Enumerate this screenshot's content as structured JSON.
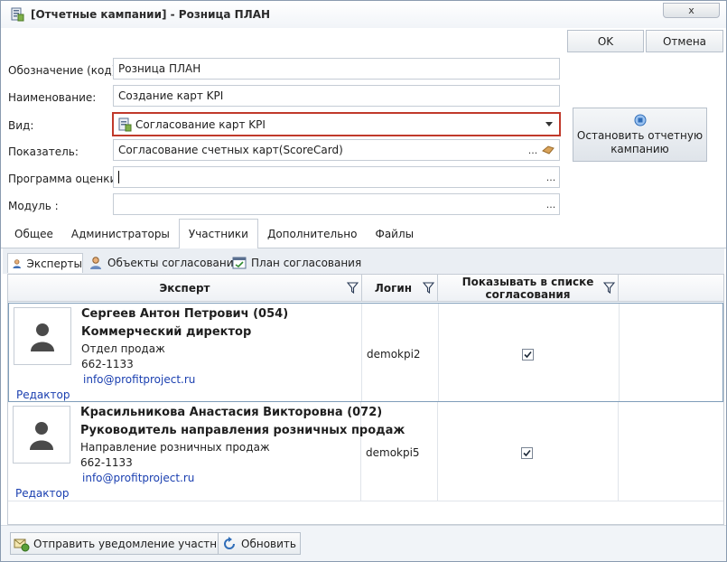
{
  "window": {
    "title": "[Отчетные кампании] - Розница ПЛАН",
    "close_label": "x"
  },
  "buttons": {
    "ok": "OK",
    "cancel": "Отмена",
    "stop": "Остановить отчетную кампанию"
  },
  "form": {
    "code": {
      "label": "Обозначение (код):",
      "value": "Розница ПЛАН"
    },
    "name": {
      "label": "Наименование:",
      "value": "Создание карт KPI"
    },
    "kind": {
      "label": "Вид:",
      "value": "Согласование карт KPI"
    },
    "indicator": {
      "label": "Показатель:",
      "value": "Согласование счетных карт(ScoreCard)",
      "dots": "..."
    },
    "program": {
      "label": "Программа оценки :",
      "value": "",
      "dots": "..."
    },
    "module": {
      "label": "Модуль :",
      "value": "",
      "dots": "..."
    }
  },
  "tabs": [
    "Общее",
    "Администраторы",
    "Участники",
    "Дополнительно",
    "Файлы"
  ],
  "subtabs": [
    "Эксперты",
    "Объекты согласования",
    "План согласования"
  ],
  "grid": {
    "headers": {
      "expert": "Эксперт",
      "login": "Логин",
      "show": "Показывать в списке согласования"
    },
    "rows": [
      {
        "name": "Сергеев Антон Петрович  (054)",
        "position": "Коммерческий директор",
        "department": "Отдел продаж",
        "phone": "662-1133",
        "email": "info@profitproject.ru",
        "editor": "Редактор",
        "login": "demokpi2",
        "checked": true
      },
      {
        "name": "Красильникова Анастасия Викторовна  (072)",
        "position": "Руководитель направления розничных продаж",
        "department": "Направление розничных продаж",
        "phone": "662-1133",
        "email": "info@profitproject.ru",
        "editor": "Редактор",
        "login": "demokpi5",
        "checked": true
      }
    ]
  },
  "bottom": {
    "notify": "Отправить уведомление участникам",
    "refresh": "Обновить"
  },
  "colors": {
    "accent_border": "#c0392b",
    "link": "#1a3fb0"
  }
}
